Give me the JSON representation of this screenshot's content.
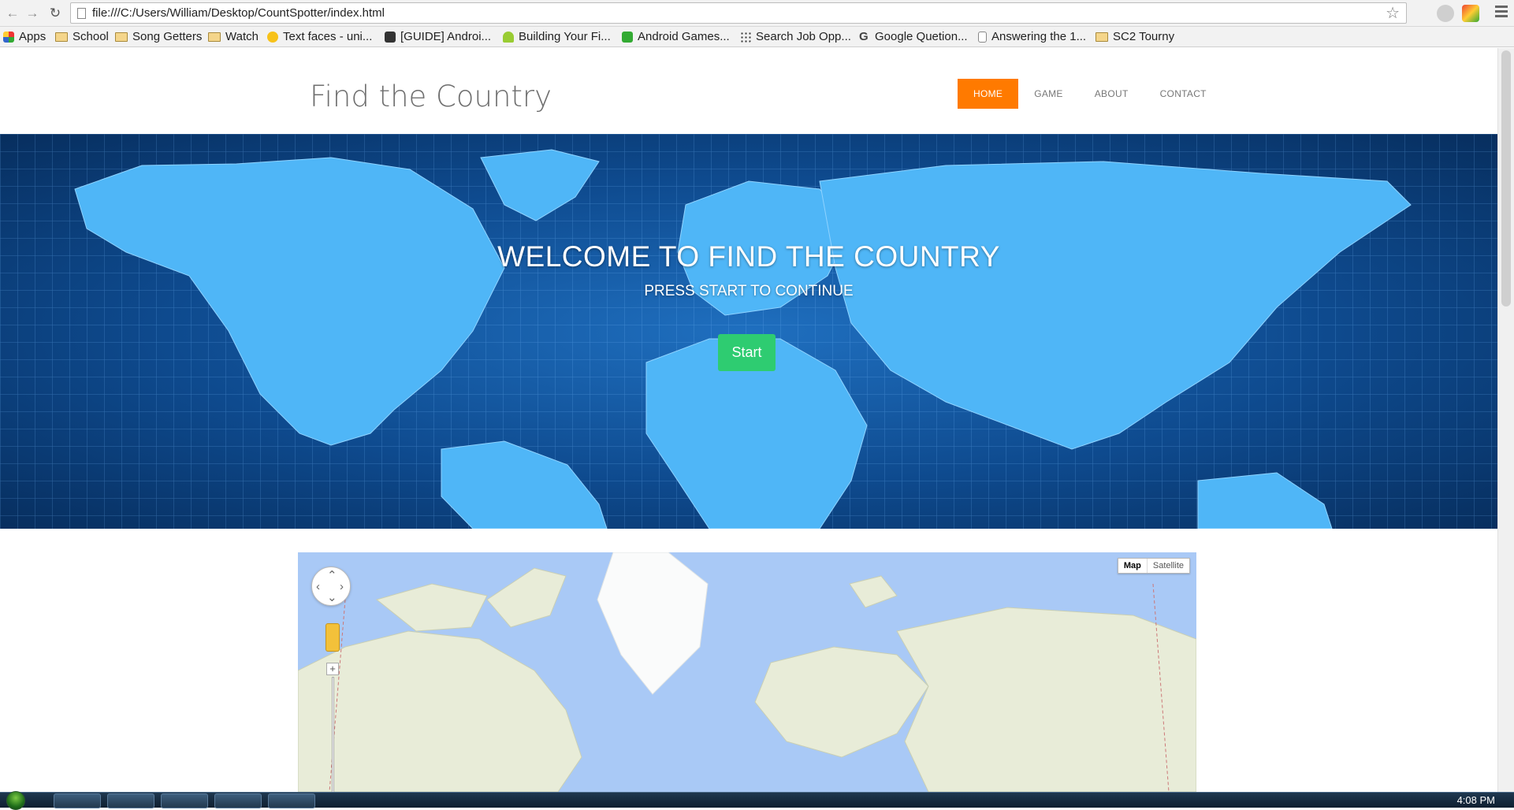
{
  "browser": {
    "url": "file:///C:/Users/William/Desktop/CountSpotter/index.html",
    "bookmarks": [
      {
        "label": "Apps",
        "icon": "apps-grid-icon"
      },
      {
        "label": "School",
        "icon": "folder-icon"
      },
      {
        "label": "Song Getters",
        "icon": "folder-icon"
      },
      {
        "label": "Watch",
        "icon": "folder-icon"
      },
      {
        "label": "Text faces - uni...",
        "icon": "emoji-face-icon"
      },
      {
        "label": "[GUIDE] Androi...",
        "icon": "xda-icon"
      },
      {
        "label": "Building Your Fi...",
        "icon": "android-icon"
      },
      {
        "label": "Android Games...",
        "icon": "car-icon"
      },
      {
        "label": "Search Job Opp...",
        "icon": "dots-icon"
      },
      {
        "label": "Google Quetion...",
        "icon": "google-icon"
      },
      {
        "label": "Answering the 1...",
        "icon": "page-icon"
      },
      {
        "label": "SC2 Tourny",
        "icon": "folder-icon"
      }
    ]
  },
  "site": {
    "brand": "Find the Country",
    "nav": [
      "HOME",
      "GAME",
      "ABOUT",
      "CONTACT"
    ],
    "active_nav": "HOME",
    "accent": "#ff7a00"
  },
  "hero": {
    "title": "WELCOME TO FIND THE COUNTRY",
    "subtitle": "PRESS START TO CONTINUE",
    "button": "Start",
    "button_color": "#2ecc71"
  },
  "map": {
    "type_options": [
      "Map",
      "Satellite"
    ],
    "selected_type": "Map"
  },
  "taskbar": {
    "clock": "4:08 PM"
  }
}
